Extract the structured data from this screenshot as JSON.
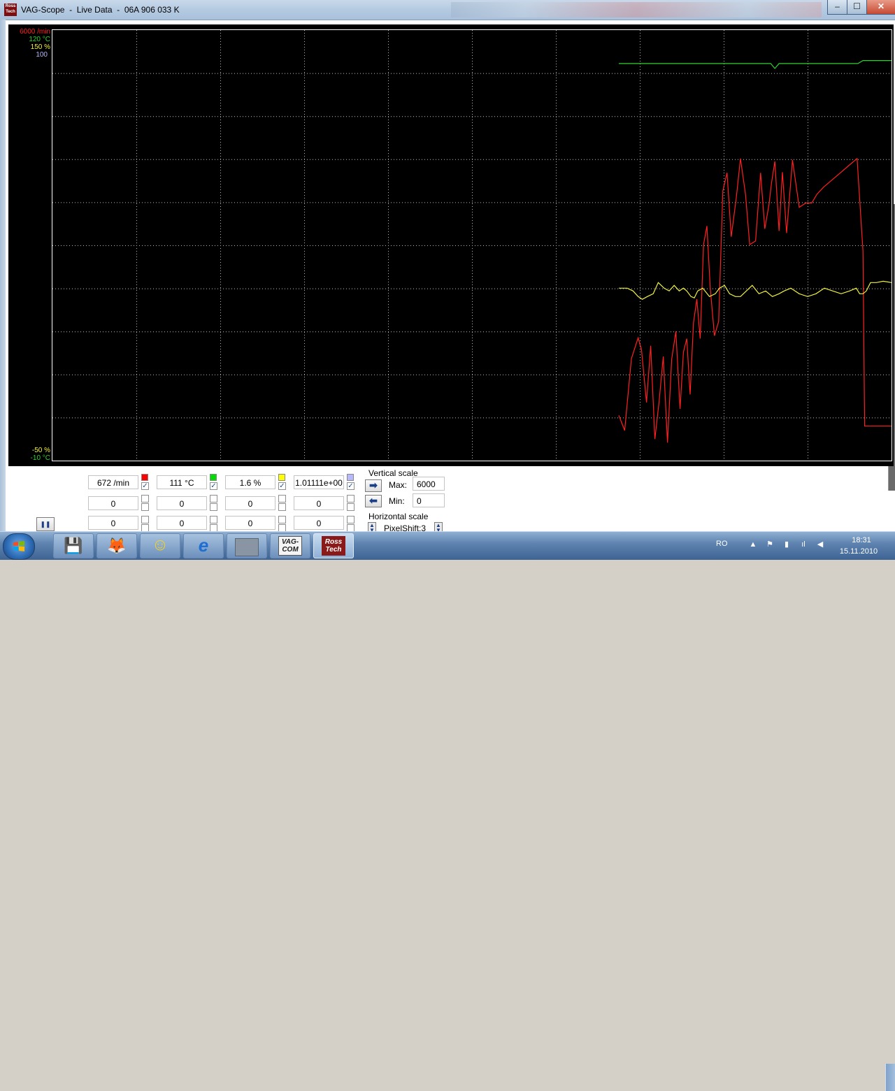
{
  "window": {
    "title": "VAG-Scope  -  Live Data  -  06A 906 033 K",
    "app_icon_text": "Ross Tech",
    "buttons": {
      "minimize": "‒",
      "maximize": "☐",
      "close": "✕"
    }
  },
  "scope": {
    "axis_labels_top": [
      {
        "text": "6000 /min",
        "color": "#ff2020"
      },
      {
        "text": "120 °C",
        "color": "#30d030"
      },
      {
        "text": "150 %",
        "color": "#f0f040"
      },
      {
        "text": "100",
        "color": "#b8b8ff"
      }
    ],
    "axis_labels_bottom": [
      {
        "text": "-50 %",
        "color": "#f0f040"
      },
      {
        "text": "-10 °C",
        "color": "#30d030"
      }
    ]
  },
  "chart_data": {
    "type": "line",
    "grid": true,
    "x_range": [
      0,
      100
    ],
    "series": [
      {
        "color": "#30d030",
        "ylim": [
          -10,
          120
        ],
        "x": [
          67.5,
          72,
          78,
          84,
          85.6,
          86.1,
          86.6,
          90,
          96,
          96.6,
          97.4,
          100
        ],
        "y": [
          109.9,
          109.9,
          109.9,
          109.9,
          109.9,
          108.4,
          109.9,
          109.9,
          109.9,
          110.8,
          110.8,
          110.8
        ]
      },
      {
        "color": "#ff2020",
        "ylim": [
          0,
          6000
        ],
        "x": [
          67.5,
          68.2,
          69.0,
          69.8,
          70.2,
          70.8,
          71.3,
          71.8,
          72.3,
          72.8,
          73.3,
          73.8,
          74.3,
          74.8,
          75.2,
          75.6,
          76.0,
          76.4,
          76.8,
          77.2,
          77.6,
          78.0,
          78.4,
          78.9,
          79.4,
          79.9,
          80.4,
          80.9,
          81.5,
          82.0,
          82.6,
          83.1,
          83.8,
          84.4,
          84.9,
          85.4,
          85.7,
          86.1,
          86.6,
          87.0,
          87.5,
          88.2,
          89.0,
          89.8,
          90.5,
          91.1,
          91.9,
          92.9,
          93.9,
          94.9,
          95.9,
          96.6,
          96.8,
          97.0,
          97.5,
          98.5,
          99.5,
          100
        ],
        "y": [
          630,
          420,
          1420,
          1710,
          1550,
          810,
          1600,
          300,
          820,
          1450,
          250,
          1410,
          1800,
          720,
          1510,
          1700,
          920,
          1920,
          2250,
          1700,
          3010,
          3270,
          2400,
          1740,
          1940,
          3760,
          4010,
          3120,
          3660,
          4210,
          3710,
          3010,
          3060,
          4010,
          3230,
          3570,
          3870,
          4170,
          3200,
          4020,
          3170,
          4190,
          3530,
          3590,
          3590,
          3710,
          3810,
          3910,
          4010,
          4110,
          4210,
          2920,
          480,
          480,
          480,
          480,
          480,
          480
        ]
      },
      {
        "color": "#f0f040",
        "ylim": [
          -50,
          150
        ],
        "x": [
          67.5,
          68.5,
          69.2,
          69.8,
          70.3,
          70.9,
          71.6,
          72.2,
          72.9,
          73.5,
          74.1,
          74.7,
          75.2,
          75.6,
          76.1,
          76.5,
          76.9,
          77.5,
          78.3,
          79.0,
          79.5,
          80.1,
          80.7,
          81.4,
          82.0,
          82.7,
          83.4,
          84.2,
          85.0,
          85.8,
          86.6,
          87.2,
          88.0,
          89.0,
          90.0,
          91.0,
          92.0,
          93.0,
          94.0,
          95.0,
          95.8,
          96.2,
          96.6,
          97.0,
          97.5,
          98.2,
          99.0,
          100
        ],
        "y": [
          30.1,
          30.1,
          28.8,
          26.2,
          24.9,
          26.2,
          27.5,
          32.7,
          30.1,
          28.8,
          31.4,
          28.8,
          30.1,
          28.8,
          26.2,
          25.6,
          28.8,
          30.1,
          26.2,
          27.5,
          30.1,
          31.4,
          27.5,
          26.2,
          26.2,
          28.8,
          31.4,
          27.5,
          28.8,
          26.2,
          27.5,
          28.8,
          30.1,
          27.5,
          26.2,
          27.5,
          30.1,
          28.8,
          27.5,
          28.8,
          30.1,
          27.5,
          27.5,
          28.8,
          32.7,
          32.7,
          33.3,
          32.7
        ]
      }
    ]
  },
  "channels": [
    {
      "value": "672 /min",
      "color": "#ff0000",
      "checked": true
    },
    {
      "value": "111 °C",
      "color": "#00dd00",
      "checked": true
    },
    {
      "value": "1.6 %",
      "color": "#ffff00",
      "checked": true
    },
    {
      "value": "1.01111e+00",
      "color": "#b8b8ff",
      "checked": true
    }
  ],
  "channel_rows_2": [
    "0",
    "0",
    "0",
    "0"
  ],
  "channel_rows_3": [
    "0",
    "0",
    "0",
    "0"
  ],
  "vertical_scale": {
    "label": "Vertical scale",
    "max_label": "Max:",
    "max_value": "6000",
    "min_label": "Min:",
    "min_value": "0"
  },
  "horizontal_scale": {
    "label": "Horizontal scale",
    "value": "PixelShift:3"
  },
  "pause_button": "❚❚",
  "taskbar": {
    "items": [
      {
        "name": "floppy-save-app",
        "label": "💾"
      },
      {
        "name": "firefox-app",
        "label": "🦊"
      },
      {
        "name": "yahoo-messenger-app",
        "label": "☺"
      },
      {
        "name": "internet-explorer-app",
        "label": "e"
      },
      {
        "name": "blank-window-app",
        "label": ""
      },
      {
        "name": "vag-com-app",
        "label": "VAG- COM"
      },
      {
        "name": "ross-tech-app",
        "label": "Ross Tech"
      }
    ],
    "language": "RO",
    "time": "18:31",
    "date": "15.11.2010"
  }
}
